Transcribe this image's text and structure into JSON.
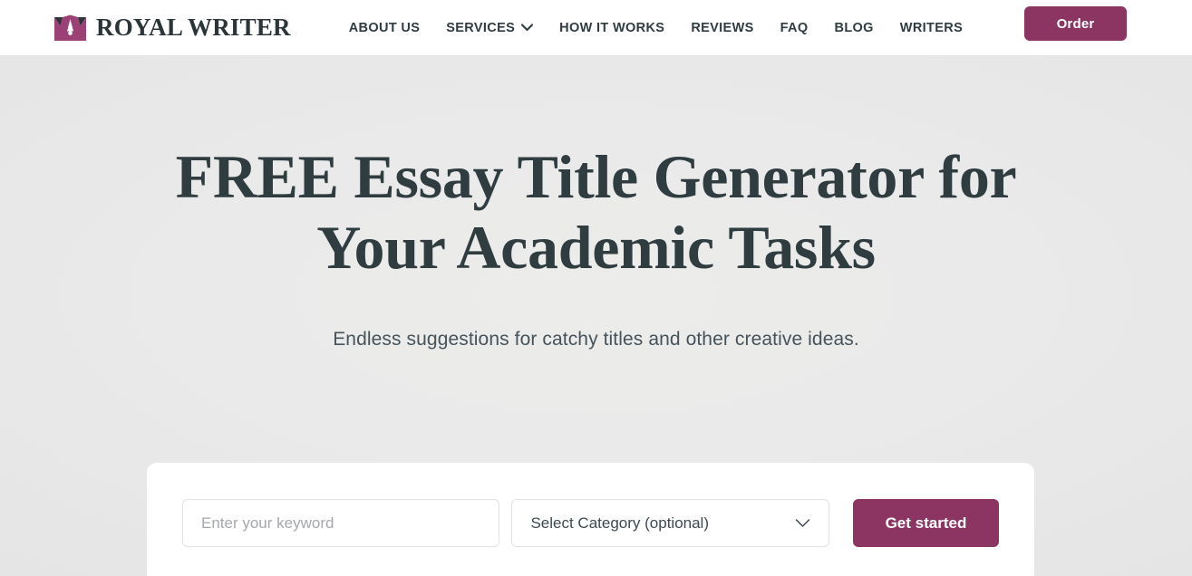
{
  "header": {
    "brand": {
      "name": "ROYAL WRITER",
      "logo_icon": "crown-pen-nib-icon",
      "logo_color": "#9c4175",
      "logo_dark_color": "#2b3538"
    },
    "nav": [
      {
        "label": "ABOUT US",
        "has_chevron": false
      },
      {
        "label": "SERVICES",
        "has_chevron": true
      },
      {
        "label": "HOW IT WORKS",
        "has_chevron": false
      },
      {
        "label": "REVIEWS",
        "has_chevron": false
      },
      {
        "label": "FAQ",
        "has_chevron": false
      },
      {
        "label": "BLOG",
        "has_chevron": false
      },
      {
        "label": "WRITERS",
        "has_chevron": false
      }
    ],
    "order_button": {
      "label": "Order",
      "color": "#8c3563"
    }
  },
  "hero": {
    "title": "FREE Essay Title Generator for Your Academic Tasks",
    "subtitle": "Endless suggestions for catchy titles and other creative ideas.",
    "background_color": "#e8e8e8",
    "title_color": "#2f3c40"
  },
  "form": {
    "keyword_input": {
      "value": "",
      "placeholder": "Enter your keyword"
    },
    "category_select": {
      "selected_label": "Select Category (optional)",
      "chevron_icon": "chevron-down-icon"
    },
    "submit_button": {
      "label": "Get started",
      "color": "#8c3563"
    }
  }
}
